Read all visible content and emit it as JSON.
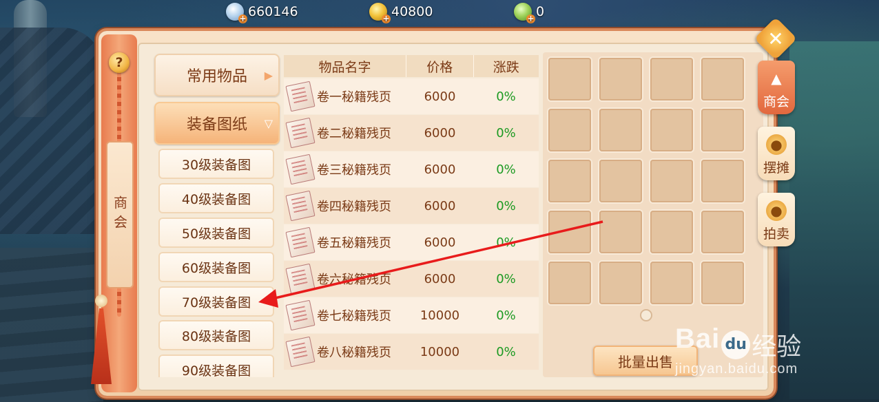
{
  "currencies": [
    {
      "icon": "silver-coin-icon",
      "value": "660146"
    },
    {
      "icon": "gold-coin-icon",
      "value": "40800"
    },
    {
      "icon": "jade-coin-icon",
      "value": "0"
    }
  ],
  "left_banner": {
    "help_label": "?",
    "title": "商会"
  },
  "categories": {
    "common": "常用物品",
    "equip": "装备图纸",
    "sub": [
      "30级装备图",
      "40级装备图",
      "50级装备图",
      "60级装备图",
      "70级装备图",
      "80级装备图",
      "90级装备图"
    ]
  },
  "table": {
    "headers": {
      "name": "物品名字",
      "price": "价格",
      "change": "涨跌"
    },
    "rows": [
      {
        "name": "卷一秘籍残页",
        "price": "6000",
        "change": "0%"
      },
      {
        "name": "卷二秘籍残页",
        "price": "6000",
        "change": "0%"
      },
      {
        "name": "卷三秘籍残页",
        "price": "6000",
        "change": "0%"
      },
      {
        "name": "卷四秘籍残页",
        "price": "6000",
        "change": "0%"
      },
      {
        "name": "卷五秘籍残页",
        "price": "6000",
        "change": "0%"
      },
      {
        "name": "卷六秘籍残页",
        "price": "6000",
        "change": "0%"
      },
      {
        "name": "卷七秘籍残页",
        "price": "10000",
        "change": "0%"
      },
      {
        "name": "卷八秘籍残页",
        "price": "10000",
        "change": "0%"
      }
    ]
  },
  "inventory": {
    "batch_sell": "批量出售"
  },
  "side_tabs": [
    {
      "label": "商会",
      "icon": "guild-icon",
      "active": true
    },
    {
      "label": "摆摊",
      "icon": "stall-icon",
      "active": false
    },
    {
      "label": "拍卖",
      "icon": "auction-icon",
      "active": false
    }
  ],
  "watermark": {
    "brand_left": "Bai",
    "brand_paw": "du",
    "brand_cn": "经验",
    "url": "jingyan.baidu.com"
  },
  "colors": {
    "accent": "#e87b4e",
    "change_green": "#1c9a22",
    "annotation_red": "#e81b1b"
  }
}
